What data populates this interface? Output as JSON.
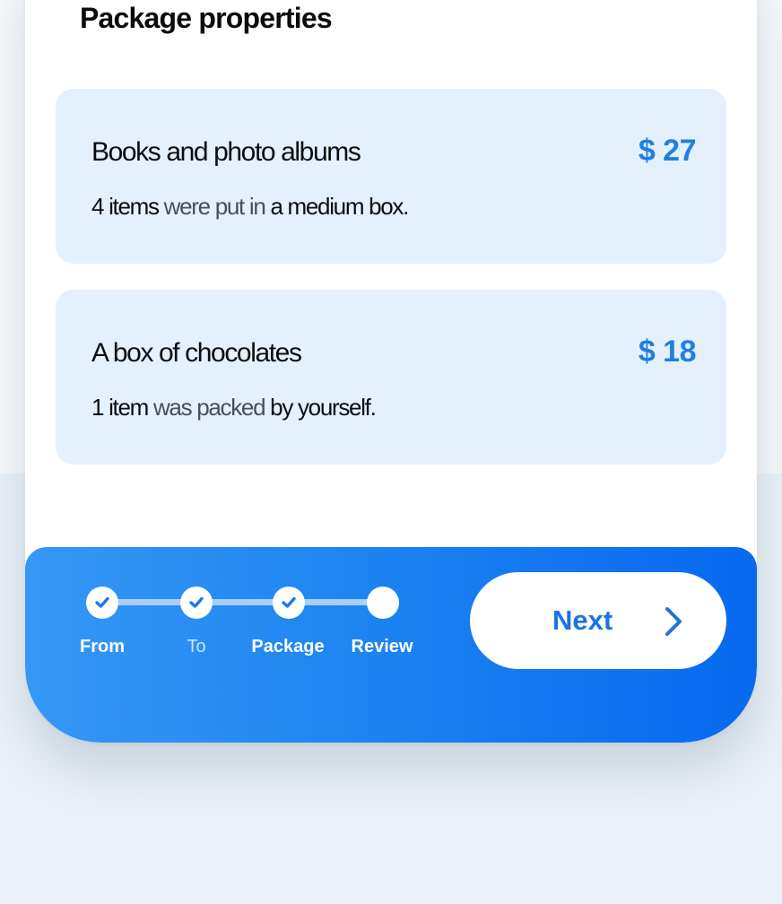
{
  "section": {
    "title": "Package properties"
  },
  "items": [
    {
      "title": "Books and photo albums",
      "price": "$ 27",
      "count": "4 items",
      "verb": " were put in ",
      "packing": "a medium box."
    },
    {
      "title": "A box of chocolates",
      "price": "$ 18",
      "count": "1 item",
      "verb": " was packed ",
      "packing": "by yourself."
    }
  ],
  "stepper": {
    "steps": [
      {
        "label": "From",
        "completed": true
      },
      {
        "label": "To",
        "completed": true
      },
      {
        "label": "Package",
        "completed": true
      },
      {
        "label": "Review",
        "completed": false
      }
    ]
  },
  "next_button": {
    "label": "Next",
    "icon": "chevron-right-icon"
  },
  "colors": {
    "accent": "#1e7fe6",
    "card_background": "#e4f0fb",
    "bar_gradient_start": "#3698f4",
    "bar_gradient_end": "#0769ef"
  }
}
